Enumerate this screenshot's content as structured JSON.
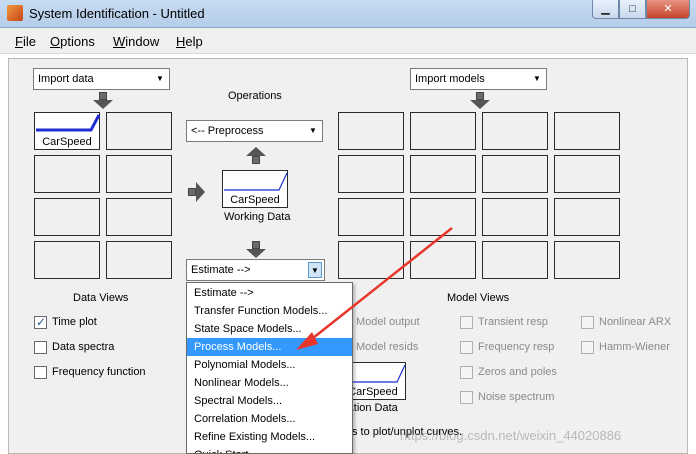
{
  "window": {
    "title": "System Identification - Untitled",
    "minimize_label": "▁",
    "maximize_label": "□",
    "close_label": "✕"
  },
  "menubar": {
    "items": [
      {
        "label": "File",
        "accel": "F",
        "rest": "ile"
      },
      {
        "label": "Options",
        "accel": "O",
        "rest": "ptions"
      },
      {
        "label": "Window",
        "accel": "W",
        "rest": "indow"
      },
      {
        "label": "Help",
        "accel": "H",
        "rest": "elp"
      }
    ]
  },
  "data_section": {
    "import_dropdown": "Import data",
    "slot_label": "CarSpeed",
    "views_title": "Data Views",
    "checks": [
      {
        "label": "Time plot",
        "checked": true
      },
      {
        "label": "Data spectra",
        "checked": false
      },
      {
        "label": "Frequency function",
        "checked": false
      }
    ]
  },
  "operations": {
    "title": "Operations",
    "preprocess_dropdown": "<-- Preprocess",
    "working_label": "CarSpeed",
    "working_caption": "Working Data",
    "estimate_dropdown": "Estimate -->",
    "validation_label": "CarSpeed",
    "validation_caption": "Validation Data"
  },
  "model_section": {
    "import_dropdown": "Import models",
    "views_title": "Model Views",
    "checks": [
      {
        "label": "Model output"
      },
      {
        "label": "Model resids"
      },
      {
        "label": "Transient resp"
      },
      {
        "label": "Frequency resp"
      },
      {
        "label": "Zeros and poles"
      },
      {
        "label": "Noise spectrum"
      },
      {
        "label": "Nonlinear ARX"
      },
      {
        "label": "Hamm-Wiener"
      }
    ],
    "hint": "s to plot/unplot curves."
  },
  "estimate_menu": {
    "items": [
      "Estimate -->",
      "Transfer Function Models...",
      "State Space Models...",
      "Process Models...",
      "Polynomial Models...",
      "Nonlinear Models...",
      "Spectral Models...",
      "Correlation Models...",
      "Refine Existing Models...",
      "Quick Start"
    ],
    "selected_index": 3
  },
  "annotation": {
    "arrow_color": "#e8362a"
  },
  "watermark": "https://blog.csdn.net/weixin_44020886"
}
